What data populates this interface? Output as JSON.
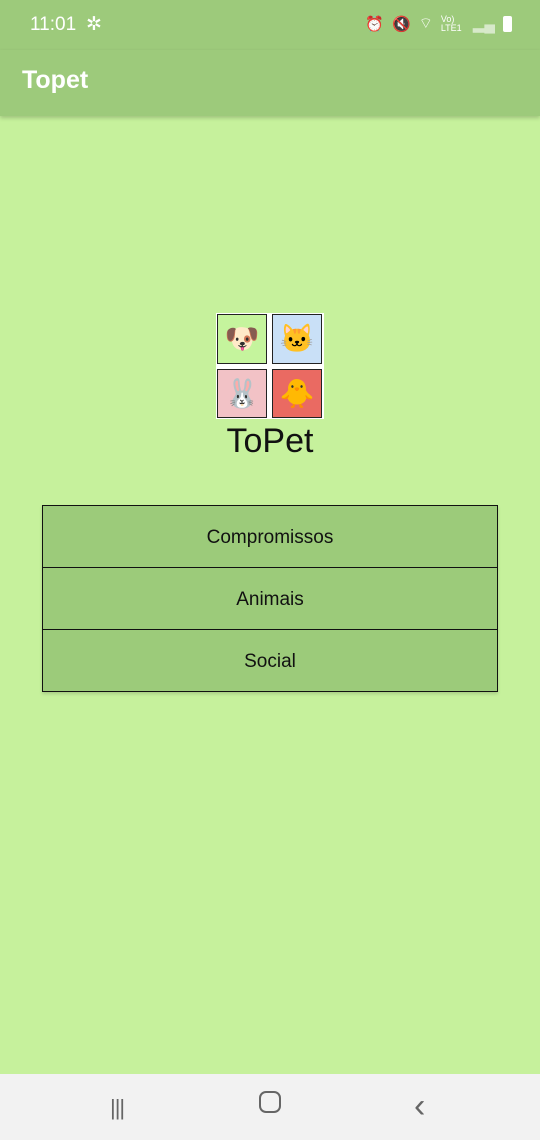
{
  "status_bar": {
    "time": "11:01",
    "icons": [
      "settings-icon",
      "alarm-icon",
      "mute-icon",
      "wifi-icon",
      "volte-icon",
      "signal-icon",
      "battery-icon"
    ],
    "network": "Vo) LTE1"
  },
  "app_bar": {
    "title": "Topet"
  },
  "logo": {
    "tiles": [
      {
        "animal": "dog",
        "emoji": "🐶",
        "bg": "#c5f49d"
      },
      {
        "animal": "cat",
        "emoji": "🐱",
        "bg": "#c9e0f7"
      },
      {
        "animal": "rabbit",
        "emoji": "🐰",
        "bg": "#f2c2c6"
      },
      {
        "animal": "chick",
        "emoji": "🐥",
        "bg": "#ea6a62"
      }
    ],
    "brand": "ToPet"
  },
  "menu": {
    "items": [
      {
        "label": "Compromissos"
      },
      {
        "label": "Animais"
      },
      {
        "label": "Social"
      }
    ]
  },
  "nav_bar": {
    "recents": "|||",
    "home": "▢",
    "back": "‹"
  },
  "colors": {
    "primary": "#9dca7b",
    "background": "#c6f19c",
    "button": "#9ccb7a"
  }
}
